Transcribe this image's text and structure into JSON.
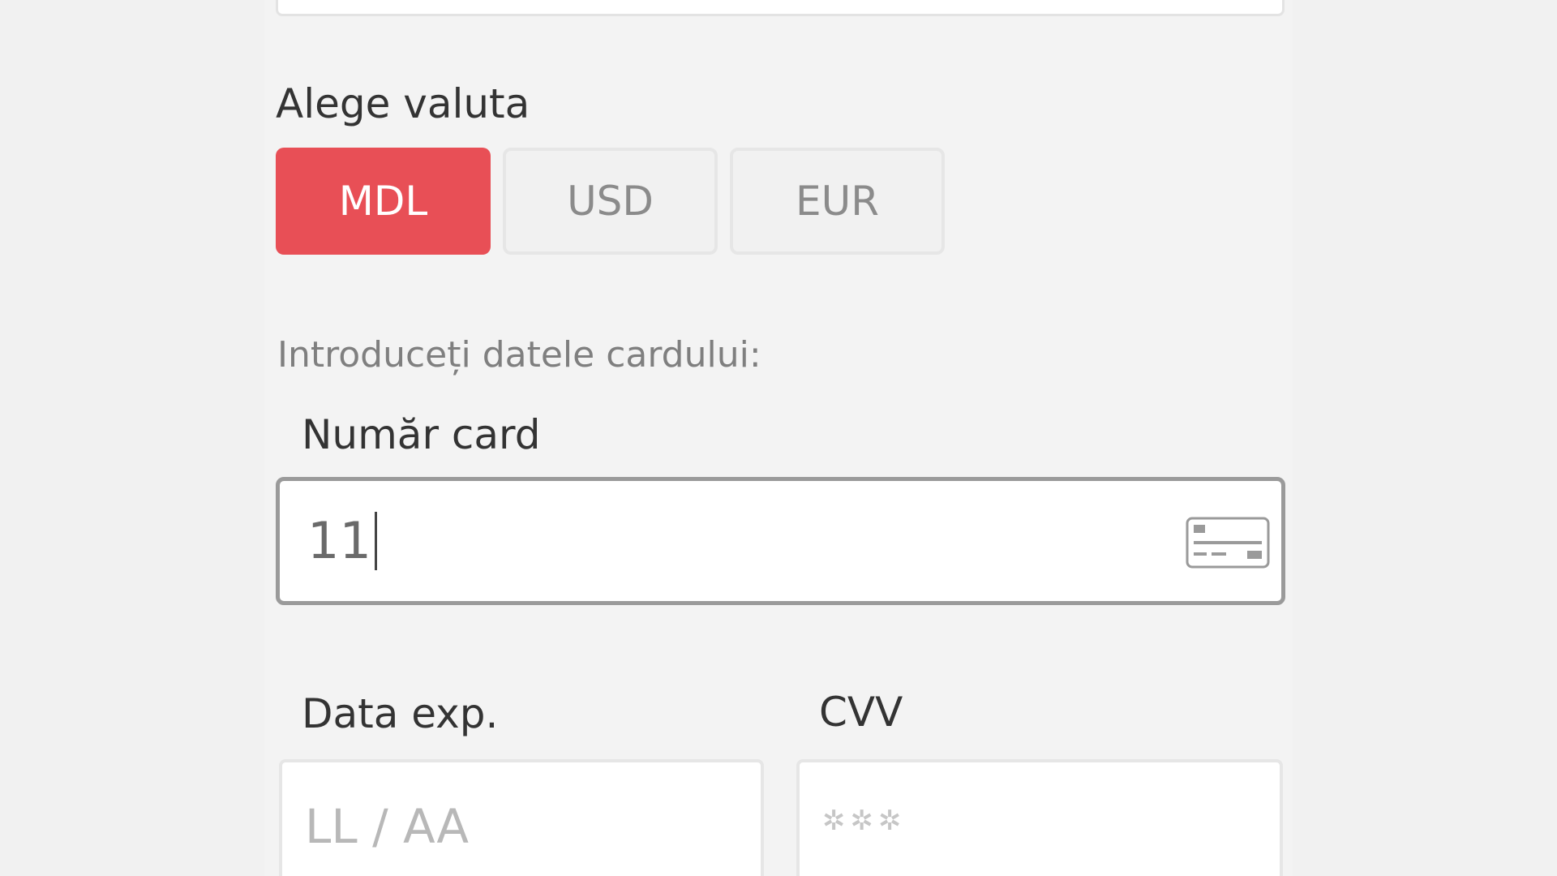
{
  "currency": {
    "title": "Alege valuta",
    "options": [
      "MDL",
      "USD",
      "EUR"
    ],
    "selected": "MDL",
    "accent_color": "#e84f56"
  },
  "card_section": {
    "hint": "Introduceți datele cardului:",
    "card_number": {
      "label": "Număr card",
      "value": "11",
      "icon": "credit-card-icon"
    },
    "expiry": {
      "label": "Data exp.",
      "placeholder": "LL / AA"
    },
    "cvv": {
      "label": "CVV",
      "placeholder": "✲✲✲"
    }
  }
}
